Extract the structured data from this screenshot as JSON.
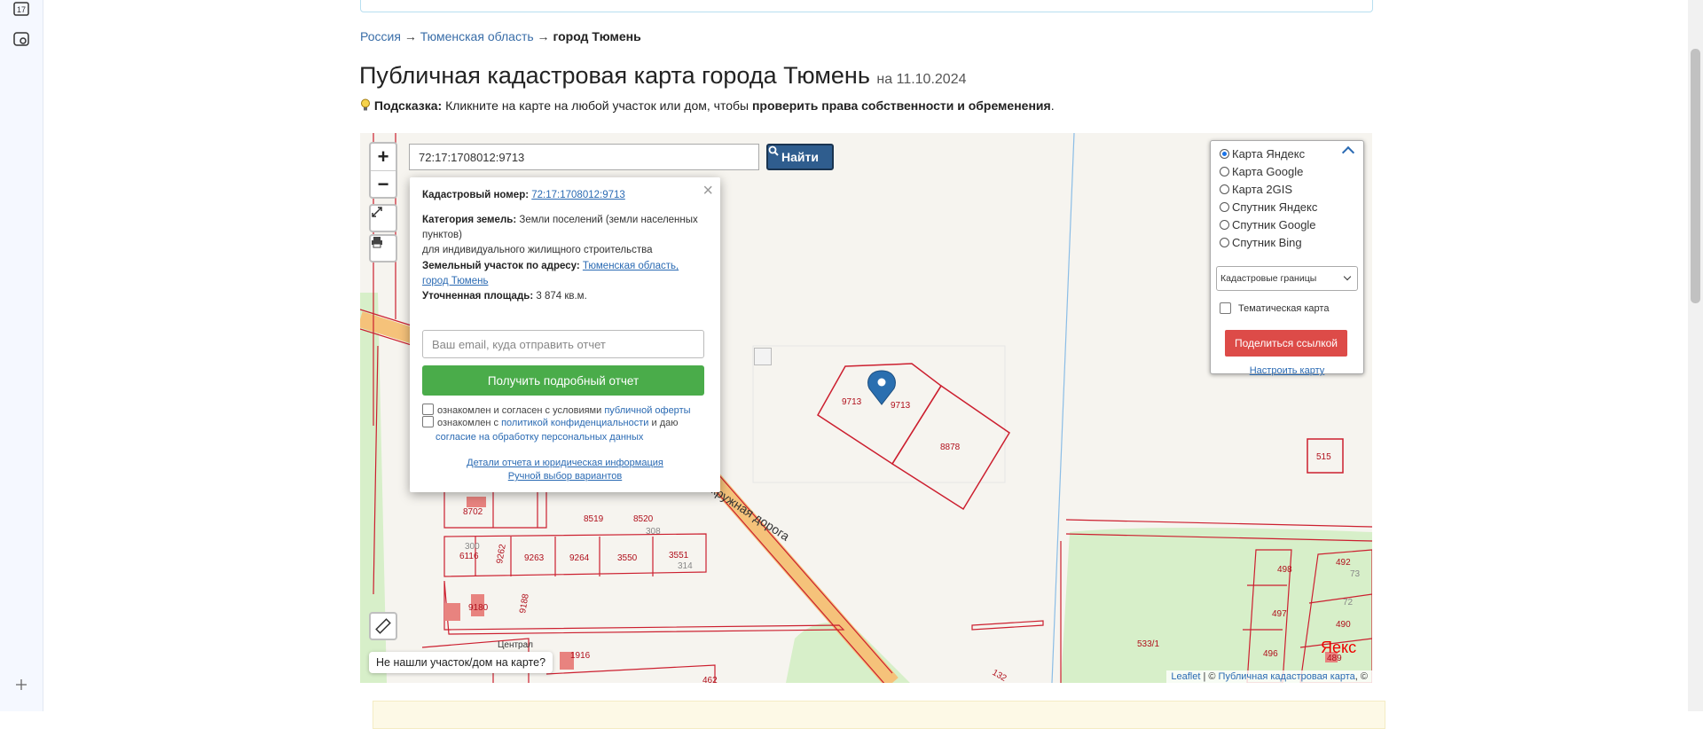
{
  "sidebar": {
    "icons": [
      "calendar-icon",
      "camera-icon",
      "plus-icon"
    ],
    "calendar_day": "17"
  },
  "breadcrumbs": [
    "Россия",
    "Тюменская область",
    "город Тюмень"
  ],
  "breadcrumb_sep": "→",
  "page": {
    "title": "Публичная кадастровая карта города Тюмень",
    "date": "на 11.10.2024"
  },
  "hint": {
    "label": "Подсказка:",
    "text": "Кликните на карте на любой участок или дом, чтобы",
    "bold": "проверить права собственности и обременения",
    "end": "."
  },
  "search": {
    "value": "72:17:1708012:9713",
    "button": "Найти"
  },
  "popup": {
    "cadnum_label": "Кадастровый номер:",
    "cadnum": "72:17:1708012:9713",
    "category_label": "Категория земель:",
    "category": "Земли поселений (земли населенных пунктов)",
    "category_use": "для индивидуального жилищного строительства",
    "address_label": "Земельный участок по адресу:",
    "address": "Тюменская область, город Тюмень",
    "area_label": "Уточненная площадь:",
    "area": "3 874 кв.м.",
    "email_placeholder": "Ваш email, куда отправить отчет",
    "report_button": "Получить подробный отчет",
    "agree1_text": "ознакомлен и согласен с условиями",
    "agree1_link": "публичной оферты",
    "agree2_text": "ознакомлен с",
    "agree2_link": "политикой конфиденциальности",
    "agree2_mid": "и даю",
    "agree2_link2": "согласие на обработку персональных данных",
    "details_link": "Детали отчета и юридическая информация",
    "manual_link": "Ручной выбор вариантов"
  },
  "layers": {
    "options": [
      "Карта Яндекс",
      "Карта Google",
      "Карта 2GIS",
      "Спутник Яндекс",
      "Спутник Google",
      "Спутник Bing"
    ],
    "selected": "Карта Яндекс",
    "select_value": "Кадастровые границы",
    "thematic": "Тематическая карта",
    "share": "Поделиться ссылкой",
    "setup": "Настроить карту"
  },
  "map": {
    "not_found": "Не нашли участок/дом на карте?",
    "attrib_leaflet": "Leaflet",
    "attrib_sep": "| ©",
    "attrib_pkk": "Публичная кадастровая карта",
    "attrib_end": ", ©",
    "yandex_y": "Я",
    "yandex_rest": "екс",
    "road_label": "кружная дорога",
    "street_label": "Централ",
    "parcels": [
      "9713",
      "9713",
      "8878",
      "515",
      "8702",
      "8519",
      "8520",
      "308",
      "6116",
      "300",
      "9262",
      "9263",
      "9264",
      "3550",
      "3551",
      "314",
      "9180",
      "9188",
      "1916",
      "462",
      "132",
      "533/1",
      "498",
      "497",
      "496",
      "492",
      "73",
      "72",
      "490",
      "489"
    ]
  },
  "colors": {
    "parcel": "#cc1f2f",
    "road": "#f5c27a",
    "green": "#d7efc9",
    "accent": "#2f5d8e"
  }
}
